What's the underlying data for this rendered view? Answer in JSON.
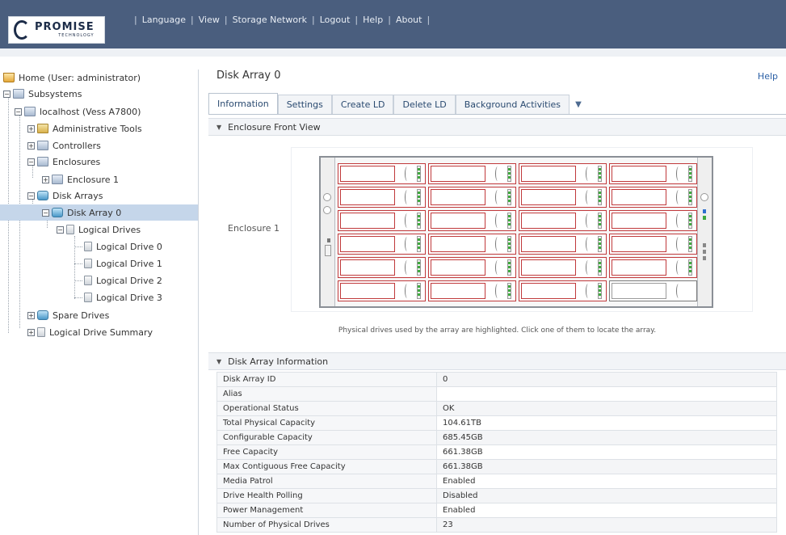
{
  "app": {
    "logo_text": "PROMISE",
    "logo_subtext": "TECHNOLOGY"
  },
  "topnav": [
    "Language",
    "View",
    "Storage Network",
    "Logout",
    "Help",
    "About"
  ],
  "tree": {
    "home": "Home (User: administrator)",
    "subsystems": "Subsystems",
    "localhost": "localhost (Vess A7800)",
    "admin_tools": "Administrative Tools",
    "controllers": "Controllers",
    "enclosures": "Enclosures",
    "enclosure1": "Enclosure 1",
    "disk_arrays": "Disk Arrays",
    "disk_array0": "Disk Array 0",
    "logical_drives": "Logical Drives",
    "ld0": "Logical Drive 0",
    "ld1": "Logical Drive 1",
    "ld2": "Logical Drive 2",
    "ld3": "Logical Drive 3",
    "spare_drives": "Spare Drives",
    "ld_summary": "Logical Drive Summary"
  },
  "main": {
    "title": "Disk Array 0",
    "help": "Help",
    "tabs": [
      "Information",
      "Settings",
      "Create LD",
      "Delete LD",
      "Background Activities"
    ],
    "enclosure_section": "Enclosure Front View",
    "enclosure_label": "Enclosure 1",
    "caption": "Physical drives used by the array are highlighted. Click one of them to locate the array.",
    "info_section": "Disk Array Information",
    "info_rows": [
      {
        "key": "Disk Array ID",
        "value": "0"
      },
      {
        "key": "Alias",
        "value": ""
      },
      {
        "key": "Operational Status",
        "value": "OK"
      },
      {
        "key": "Total Physical Capacity",
        "value": "104.61TB"
      },
      {
        "key": "Configurable Capacity",
        "value": "685.45GB"
      },
      {
        "key": "Free Capacity",
        "value": "661.38GB"
      },
      {
        "key": "Max Contiguous Free Capacity",
        "value": "661.38GB"
      },
      {
        "key": "Media Patrol",
        "value": "Enabled"
      },
      {
        "key": "Drive Health Polling",
        "value": "Disabled"
      },
      {
        "key": "Power Management",
        "value": "Enabled"
      },
      {
        "key": "Number of Physical Drives",
        "value": "23"
      }
    ]
  },
  "enclosure": {
    "columns": 4,
    "rows": 6,
    "highlighted_drives": 23,
    "highlight_color": "#c0393b",
    "led_color": "#3fa93f"
  }
}
